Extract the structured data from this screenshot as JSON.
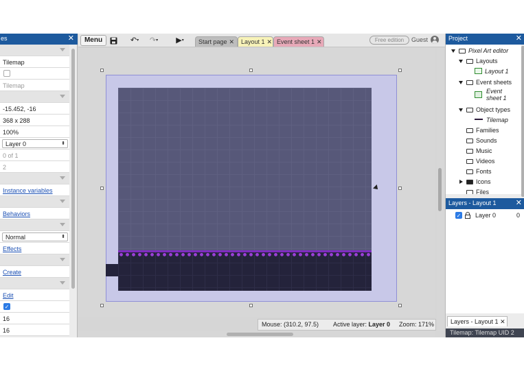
{
  "left_panel": {
    "title": "es",
    "rows": {
      "plugin": "Tilemap",
      "name": "Tilemap",
      "position": "-15.452, -16",
      "size": "368 x 288",
      "opacity": "100%",
      "layer": "Layer 0",
      "z_index": "0 of 1",
      "uid": "2",
      "instance_variables": "Instance variables",
      "behaviors": "Behaviors",
      "blend_mode": "Normal",
      "effects": "Effects",
      "create": "Create",
      "edit": "Edit",
      "tile_width": "16",
      "tile_height": "16"
    }
  },
  "toolbar": {
    "menu_label": "Menu",
    "tabs": [
      {
        "label": "Start page"
      },
      {
        "label": "Layout 1"
      },
      {
        "label": "Event sheet 1"
      }
    ],
    "badge": "Free edition",
    "user": "Guest",
    "colors": {
      "tab_layout": "#f7f2b8",
      "tab_event": "#e7a9b8",
      "tab_start": "#bdbdbd"
    }
  },
  "status_bar": {
    "mouse_label": "Mouse: (310.2, 97.5)",
    "active_layer_prefix": "Active layer: ",
    "active_layer_value": "Layer 0",
    "zoom": "Zoom: 171%"
  },
  "project": {
    "title": "Project",
    "tree": {
      "root": "Pixel Art editor",
      "layouts": "Layouts",
      "layout1": "Layout 1",
      "event_sheets": "Event sheets",
      "event_sheet1_line1": "Event",
      "event_sheet1_line2": "sheet 1",
      "object_types": "Object types",
      "tilemap": "Tilemap",
      "families": "Families",
      "sounds": "Sounds",
      "music": "Music",
      "videos": "Videos",
      "fonts": "Fonts",
      "icons": "Icons",
      "files": "Files"
    }
  },
  "layers": {
    "title": "Layers - Layout 1",
    "items": [
      {
        "name": "Layer 0",
        "index": "0"
      }
    ],
    "bottom_tab": "Layers - Layout 1",
    "uid_bar": "Tilemap: Tilemap UID 2"
  },
  "colors": {
    "accent": "#1d5a9e",
    "tilemap_bg": "#575879",
    "grass": "#9b3fd8",
    "ground": "#24233b",
    "layout_bg": "#c8c8e8"
  }
}
